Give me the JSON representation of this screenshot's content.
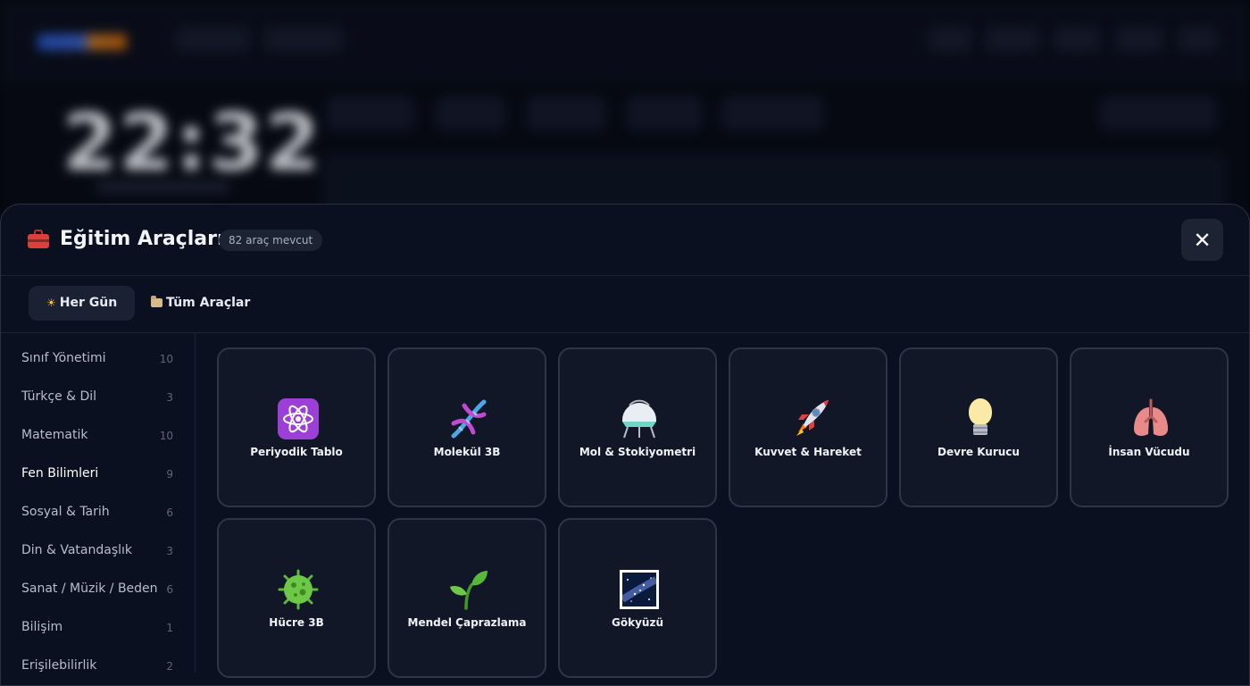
{
  "modal": {
    "title": "Eğitim Araçları",
    "tool_count": "82 araç mevcut",
    "header_icon": "toolbox-icon",
    "close_icon": "close-icon",
    "close_glyph": "✕"
  },
  "tabs": [
    {
      "label": "Her Gün",
      "icon": "sun-icon",
      "glyph": "☀",
      "active": true
    },
    {
      "label": "Tüm Araçlar",
      "icon": "folder-icon",
      "active": false
    }
  ],
  "categories": [
    {
      "label": "Sınıf Yönetimi",
      "count": "10"
    },
    {
      "label": "Türkçe & Dil",
      "count": "3"
    },
    {
      "label": "Matematik",
      "count": "10"
    },
    {
      "label": "Fen Bilimleri",
      "count": "9",
      "active": true
    },
    {
      "label": "Sosyal & Tarih",
      "count": "6"
    },
    {
      "label": "Din & Vatandaşlık",
      "count": "3"
    },
    {
      "label": "Sanat / Müzik / Beden",
      "count": "6"
    },
    {
      "label": "Bilişim",
      "count": "1"
    },
    {
      "label": "Erişilebilirlik",
      "count": "2"
    }
  ],
  "tools": [
    {
      "label": "Periyodik Tablo",
      "icon": "atom-icon"
    },
    {
      "label": "Molekül 3B",
      "icon": "dna-icon"
    },
    {
      "label": "Mol & Stokiyometri",
      "icon": "flask-icon"
    },
    {
      "label": "Kuvvet & Hareket",
      "icon": "rocket-icon"
    },
    {
      "label": "Devre Kurucu",
      "icon": "light-bulb-icon"
    },
    {
      "label": "İnsan Vücudu",
      "icon": "lungs-icon"
    },
    {
      "label": "Hücre 3B",
      "icon": "microbe-icon"
    },
    {
      "label": "Mendel Çaprazlama",
      "icon": "seedling-icon"
    },
    {
      "label": "Gökyüzü",
      "icon": "milky-way-icon"
    }
  ],
  "background": {
    "clock": "22:32"
  },
  "colors": {
    "modal_bg": "#0b1020",
    "card_bg": "#111727",
    "card_border": "#2e3547",
    "accent_atom": "#9b3fd6"
  }
}
